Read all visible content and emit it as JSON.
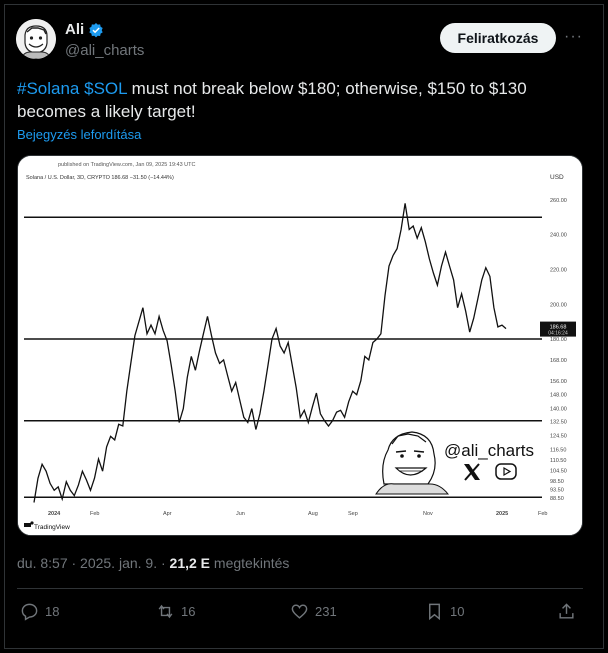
{
  "author": {
    "name": "Ali",
    "handle": "@ali_charts"
  },
  "subscribe_label": "Feliratkozás",
  "more_label": "···",
  "tweet": {
    "part1_tag": "#Solana $SOL",
    "part1_rest": " must not break below $180; otherwise, $150 to $130 becomes a likely target!",
    "translate_label": "Bejegyzés lefordítása"
  },
  "chart_data": {
    "type": "line",
    "header_note": "published on TradingView.com, Jan 09, 2025 19:43 UTC",
    "symbol_line": "Solana / U.S. Dollar, 3D, CRYPTO  186.68  −31.50 (−14.44%)",
    "currency": "USD",
    "price_label": "186.68",
    "countdown_label": "04:16:24",
    "ylim": [
      84,
      268
    ],
    "y_ticks": [
      "260.00",
      "240.00",
      "220.00",
      "200.00",
      "180.00",
      "168.00",
      "156.00",
      "148.00",
      "140.00",
      "132.50",
      "124.50",
      "116.50",
      "110.50",
      "104.50",
      "98.50",
      "93.50",
      "88.50"
    ],
    "x_ticks": [
      "2024",
      "Feb",
      "Apr",
      "Jun",
      "Aug",
      "Sep",
      "Nov",
      "2025",
      "Feb"
    ],
    "levels": [
      250,
      180,
      133,
      89
    ],
    "x": [
      0,
      1,
      2,
      3,
      4,
      5,
      6,
      7,
      8,
      9,
      10,
      11,
      12,
      13,
      14,
      15,
      16,
      17,
      18,
      19,
      20,
      21,
      22,
      23,
      24,
      25,
      26,
      27,
      28,
      29,
      30,
      31,
      32,
      33,
      34,
      35,
      36,
      37,
      38,
      39,
      40,
      41,
      42,
      43,
      44,
      45,
      46,
      47,
      48,
      49,
      50,
      51,
      52,
      53,
      54,
      55,
      56,
      57,
      58,
      59,
      60,
      61,
      62,
      63,
      64,
      65,
      66,
      67,
      68,
      69,
      70,
      71,
      72,
      73,
      74,
      75,
      76,
      77,
      78,
      79,
      80,
      81,
      82,
      83,
      84,
      85,
      86,
      87,
      88,
      89,
      90,
      91,
      92,
      93,
      94,
      95,
      96,
      97,
      98,
      99,
      100,
      101,
      102,
      103,
      104,
      105,
      106,
      107,
      108,
      109,
      110,
      111,
      112,
      113,
      114,
      115,
      116,
      117,
      118,
      119,
      120,
      121,
      122,
      123,
      124,
      125,
      126,
      127,
      128,
      129,
      130,
      131,
      132,
      133,
      134,
      135,
      136,
      137,
      138,
      139,
      140,
      141,
      142,
      143,
      144,
      145,
      146,
      147,
      148,
      149,
      150,
      151,
      152,
      153,
      154,
      155,
      156,
      157,
      158,
      159
    ],
    "values": [
      86,
      100,
      108,
      104,
      97,
      93,
      95,
      88,
      98,
      93,
      90,
      96,
      104,
      99,
      93,
      100,
      111,
      104,
      118,
      124,
      122,
      131,
      130,
      150,
      166,
      182,
      190,
      198,
      183,
      188,
      183,
      193,
      185,
      179,
      165,
      150,
      132,
      140,
      158,
      170,
      162,
      173,
      183,
      193,
      182,
      172,
      166,
      168,
      159,
      150,
      155,
      145,
      135,
      132,
      140,
      128,
      137,
      150,
      165,
      180,
      186,
      176,
      172,
      178,
      165,
      152,
      135,
      139,
      132,
      141,
      149,
      137,
      133,
      130,
      133,
      138,
      139,
      135,
      144,
      150,
      148,
      156,
      170,
      168,
      178,
      180,
      183,
      205,
      222,
      228,
      232,
      243,
      258,
      243,
      245,
      238,
      244,
      236,
      226,
      218,
      211,
      222,
      230,
      222,
      214,
      198,
      206,
      196,
      184,
      192,
      203,
      214,
      221,
      216,
      198,
      187,
      188,
      186,
      186,
      186,
      186,
      186,
      186,
      186,
      186,
      186,
      186,
      186,
      186,
      186,
      186,
      186,
      186,
      186,
      186,
      186,
      186,
      186,
      186,
      186,
      186,
      186,
      186,
      186,
      186,
      186,
      186,
      186,
      186,
      186,
      186,
      186,
      186,
      186,
      186,
      186,
      186,
      186,
      186,
      186
    ],
    "n_points": 118,
    "watermark_handle": "@ali_charts",
    "logo_text": "TradingView"
  },
  "meta": {
    "time_date": "du. 8:57 · 2025. jan. 9. · ",
    "views_value": "21,2 E",
    "views_label": " megtekintés"
  },
  "actions": {
    "replies": "18",
    "reposts": "16",
    "likes": "231",
    "bookmarks": "10"
  }
}
